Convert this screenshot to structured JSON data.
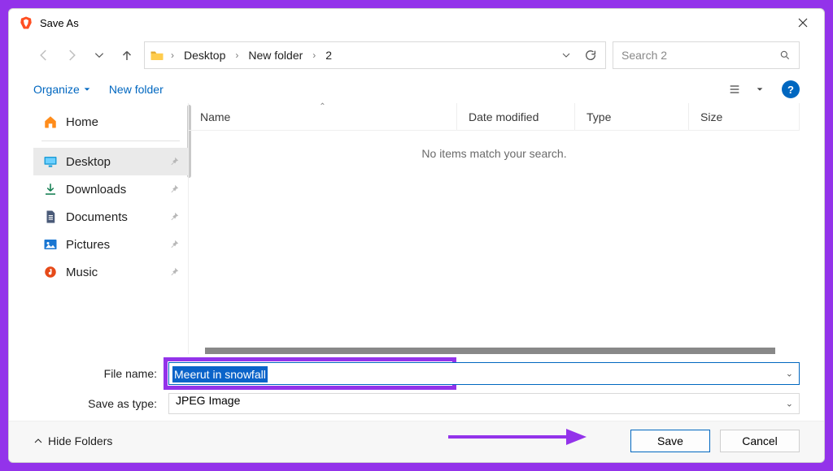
{
  "window": {
    "title": "Save As"
  },
  "nav": {
    "breadcrumbs": [
      "Desktop",
      "New folder",
      "2"
    ],
    "search_placeholder": "Search 2"
  },
  "toolbar": {
    "organize": "Organize",
    "new_folder": "New folder"
  },
  "sidebar": {
    "items": [
      {
        "label": "Home",
        "icon": "home-icon"
      },
      {
        "label": "Desktop",
        "icon": "desktop-icon"
      },
      {
        "label": "Downloads",
        "icon": "download-icon"
      },
      {
        "label": "Documents",
        "icon": "document-icon"
      },
      {
        "label": "Pictures",
        "icon": "pictures-icon"
      },
      {
        "label": "Music",
        "icon": "music-icon"
      }
    ]
  },
  "columns": {
    "name": "Name",
    "date": "Date modified",
    "type": "Type",
    "size": "Size"
  },
  "content": {
    "empty_message": "No items match your search."
  },
  "form": {
    "filename_label": "File name:",
    "filename_value": "Meerut in snowfall",
    "saveastype_label": "Save as type:",
    "saveastype_value": "JPEG Image"
  },
  "footer": {
    "hide_folders": "Hide Folders",
    "save": "Save",
    "cancel": "Cancel"
  }
}
